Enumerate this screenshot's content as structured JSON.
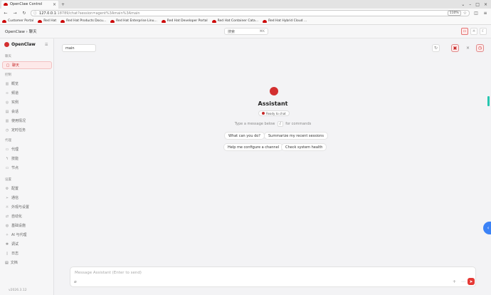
{
  "browser": {
    "tab_title": "OpenClaw Control",
    "url_host": "127.0.0.1",
    "url_path": ":18789/chat?session=agent%3Amain%3Amain",
    "zoom": "110%",
    "bookmarks": [
      "Customer Portal",
      "Red Hat",
      "Red Hat Products Docu...",
      "Red Hat Enterprise Linu...",
      "Red Hat Developer Portal",
      "Red Hat Container Cata...",
      "Red Hat Hybrid Cloud ..."
    ]
  },
  "header": {
    "breadcrumb": "OpenClaw › 聊天",
    "search_placeholder": "搜索",
    "search_shortcut": "⌘K"
  },
  "sidebar": {
    "brand": "OpenClaw",
    "groups": [
      {
        "label": "聊天",
        "items": [
          {
            "label": "聊天",
            "icon": "chat-bubble-icon",
            "active": true
          }
        ]
      },
      {
        "label": "控制",
        "items": [
          {
            "label": "概览",
            "icon": "bar-chart-icon"
          },
          {
            "label": "频道",
            "icon": "link-icon"
          },
          {
            "label": "实例",
            "icon": "radio-icon"
          },
          {
            "label": "会话",
            "icon": "document-icon"
          },
          {
            "label": "使用情况",
            "icon": "bar-chart-icon"
          },
          {
            "label": "定时任务",
            "icon": "clock-icon"
          }
        ]
      },
      {
        "label": "代理",
        "items": [
          {
            "label": "代理",
            "icon": "folder-icon"
          },
          {
            "label": "技能",
            "icon": "bolt-icon"
          },
          {
            "label": "节点",
            "icon": "monitor-icon"
          }
        ]
      },
      {
        "label": "设置",
        "items": [
          {
            "label": "配置",
            "icon": "gear-icon"
          },
          {
            "label": "通信",
            "icon": "send-icon"
          },
          {
            "label": "外观与设置",
            "icon": "sun-icon"
          },
          {
            "label": "自动化",
            "icon": "flow-icon"
          },
          {
            "label": "基础设施",
            "icon": "globe-icon"
          },
          {
            "label": "AI 与代理",
            "icon": "sparkle-icon"
          },
          {
            "label": "调试",
            "icon": "bug-icon"
          },
          {
            "label": "日志",
            "icon": "file-icon"
          }
        ]
      }
    ],
    "docs_label": "文档",
    "version": "v2026.3.12"
  },
  "main": {
    "session": "main",
    "assistant_name": "Assistant",
    "status": "Ready to chat",
    "hint_before": "Type a message below",
    "hint_key": "/",
    "hint_after": "for commands",
    "suggestions": [
      "What can you do?",
      "Summarize my recent sessions",
      "Help me configure a channel",
      "Check system health"
    ],
    "composer_placeholder": "Message Assistant (Enter to send)"
  },
  "colors": {
    "accent": "#d32f2f",
    "active_bg": "#fde9e9",
    "float_button": "#3b82f6",
    "scroll_accent": "#26c6b0"
  }
}
